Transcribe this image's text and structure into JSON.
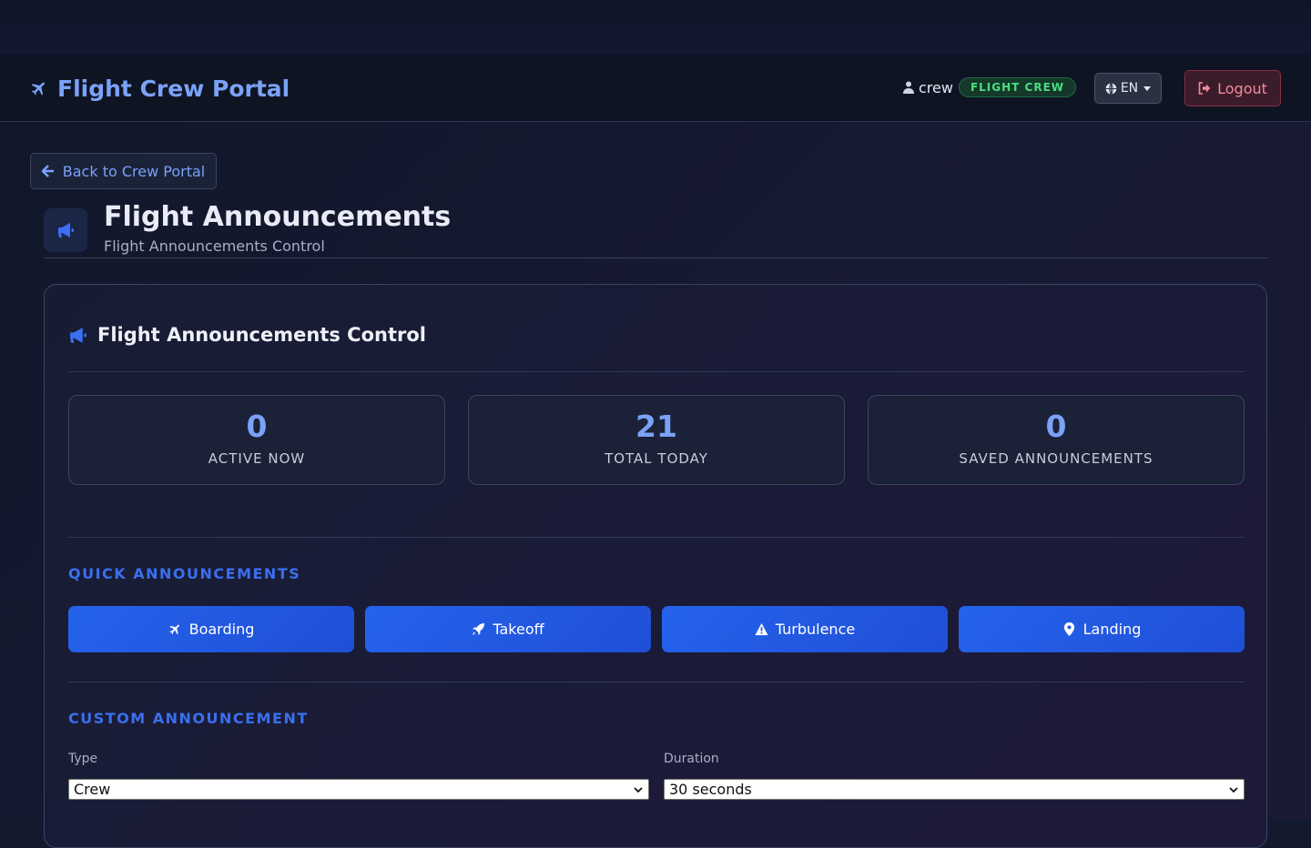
{
  "navbar": {
    "brand": "Flight Crew Portal",
    "username": "crew",
    "role_badge": "FLIGHT CREW",
    "language": "EN",
    "logout_label": "Logout"
  },
  "back_button": "Back to Crew Portal",
  "page": {
    "title": "Flight Announcements",
    "subtitle": "Flight Announcements Control"
  },
  "panel": {
    "title": "Flight Announcements Control",
    "stats": [
      {
        "value": "0",
        "label": "ACTIVE NOW"
      },
      {
        "value": "21",
        "label": "TOTAL TODAY"
      },
      {
        "value": "0",
        "label": "SAVED ANNOUNCEMENTS"
      }
    ],
    "quick_section_label": "QUICK ANNOUNCEMENTS",
    "quick_buttons": [
      {
        "label": "Boarding",
        "icon": "plane-icon"
      },
      {
        "label": "Takeoff",
        "icon": "rocket-icon"
      },
      {
        "label": "Turbulence",
        "icon": "warning-icon"
      },
      {
        "label": "Landing",
        "icon": "map-pin-icon"
      }
    ],
    "custom_section_label": "CUSTOM ANNOUNCEMENT",
    "type_label": "Type",
    "type_value": "Crew",
    "duration_label": "Duration",
    "duration_value": "30 seconds"
  },
  "colors": {
    "accent": "#7aa2f7",
    "primary_button": "#2563eb",
    "badge_green": "#4ade80",
    "logout_red": "#f28b9e"
  }
}
